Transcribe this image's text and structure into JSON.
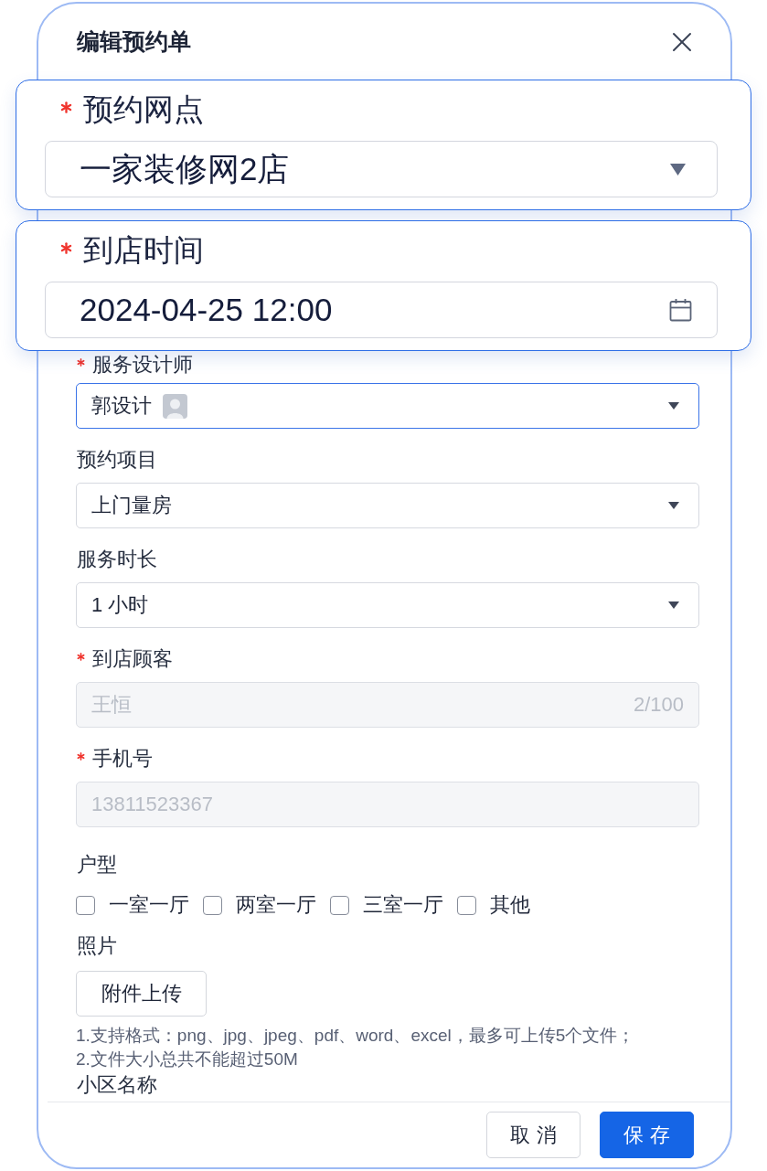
{
  "dialog": {
    "title": "编辑预约单"
  },
  "callouts": [
    {
      "kind": "select",
      "label": "预约网点",
      "required": true,
      "value": "一家装修网2店"
    },
    {
      "kind": "date",
      "label": "到店时间",
      "required": true,
      "value": "2024-04-25 12:00"
    }
  ],
  "fields": [
    {
      "kind": "select",
      "label": "服务设计师",
      "required": true,
      "value": "郭设计",
      "avatar": true,
      "focused": true
    },
    {
      "kind": "select",
      "label": "预约项目",
      "required": false,
      "value": "上门量房",
      "focused": false
    },
    {
      "kind": "select",
      "label": "服务时长",
      "required": false,
      "value": "1 小时",
      "focused": false
    },
    {
      "kind": "text",
      "label": "到店顾客",
      "required": true,
      "value": "王恒",
      "counter": "2/100",
      "disabled": true
    },
    {
      "kind": "text",
      "label": "手机号",
      "required": true,
      "value": "13811523367",
      "disabled": true
    },
    {
      "kind": "checkboxes",
      "label": "户型",
      "required": false,
      "options": [
        {
          "label": "一室一厅",
          "checked": false
        },
        {
          "label": "两室一厅",
          "checked": false
        },
        {
          "label": "三室一厅",
          "checked": false
        },
        {
          "label": "其他",
          "checked": false
        }
      ]
    },
    {
      "kind": "upload",
      "label": "照片",
      "required": false,
      "button": "附件上传",
      "hints": [
        "1.支持格式：png、jpg、jpeg、pdf、word、excel，最多可上传5个文件；",
        "2.文件大小总共不能超过50M"
      ]
    },
    {
      "kind": "label",
      "label": "小区名称",
      "required": false
    }
  ],
  "footer": {
    "buttons": [
      {
        "label": "取 消",
        "kind": "default"
      },
      {
        "label": "保 存",
        "kind": "primary"
      }
    ]
  }
}
